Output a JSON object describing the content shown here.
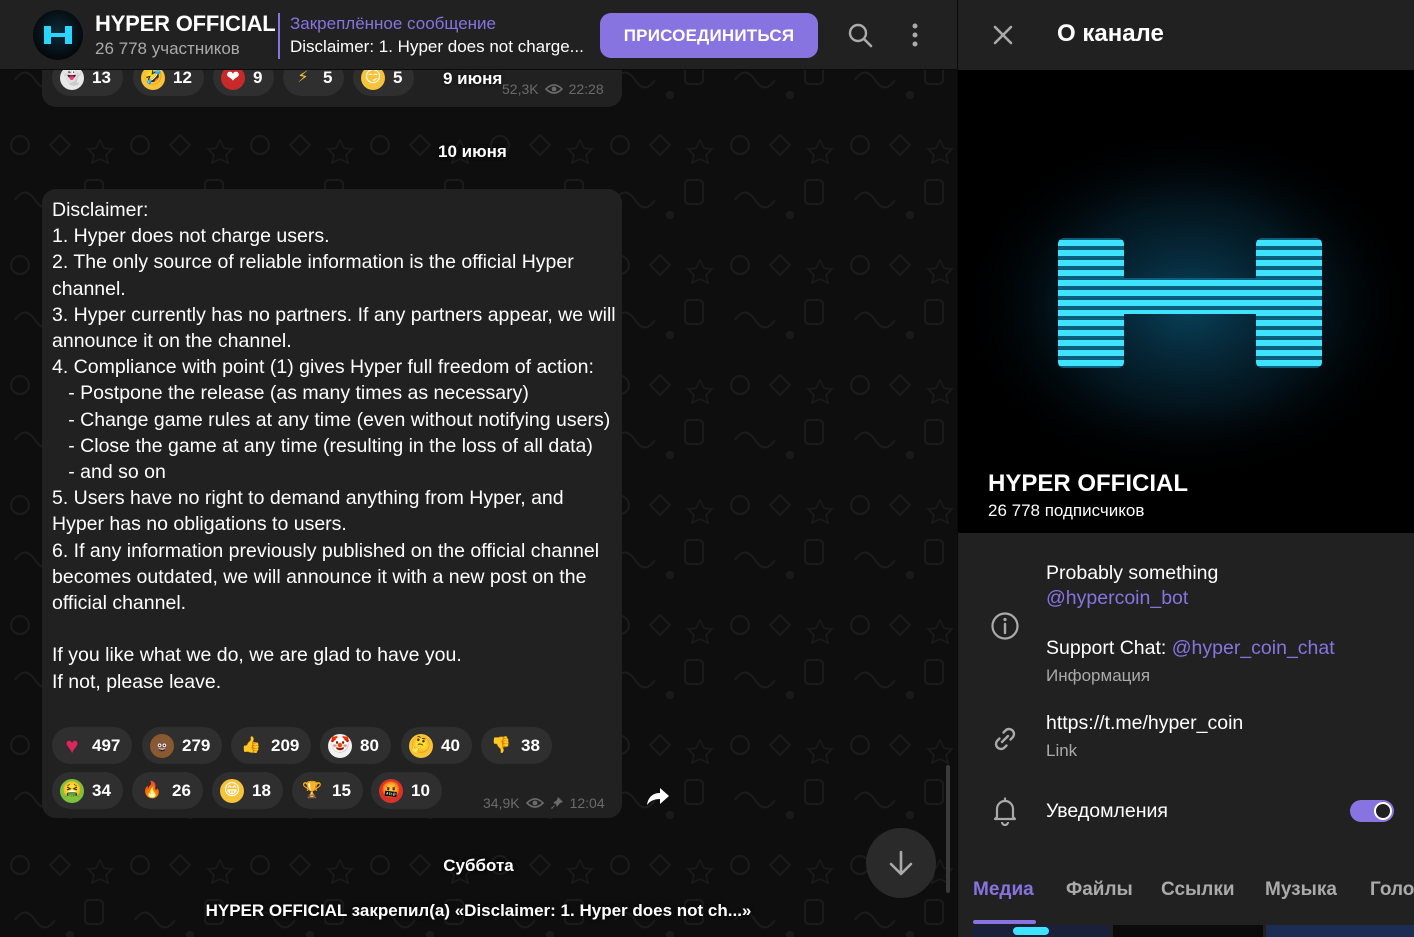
{
  "chat": {
    "header": {
      "title": "HYPER OFFICIAL",
      "subtitle": "26 778 участников",
      "pinned_label": "Закреплённое сообщение",
      "pinned_text": "Disclaimer: 1. Hyper does not charge...",
      "join_label": "ПРИСОЕДИНИТЬСЯ"
    },
    "top_reactions": [
      {
        "emoji": "ghost",
        "count": "13"
      },
      {
        "emoji": "rofl",
        "count": "12"
      },
      {
        "emoji": "heart-on-fire",
        "count": "9"
      },
      {
        "emoji": "lightning",
        "count": "5"
      },
      {
        "emoji": "smirk",
        "count": "5"
      }
    ],
    "top_meta": {
      "views": "52,3K",
      "time": "22:28"
    },
    "date_1": "9 июня",
    "date_2": "10 июня",
    "message": {
      "text": "Disclaimer:\n1. Hyper does not charge users.\n2. The only source of reliable information is the official Hyper channel.\n3. Hyper currently has no partners. If any partners appear, we will announce it on the channel.\n4. Compliance with point (1) gives Hyper full freedom of action:\n   - Postpone the release (as many times as necessary)\n   - Change game rules at any time (even without notifying users)\n   - Close the game at any time (resulting in the loss of all data)\n   - and so on\n5. Users have no right to demand anything from Hyper, and Hyper has no obligations to users.\n6. If any information previously published on the official channel becomes outdated, we will announce it with a new post on the official channel.\n\nIf you like what we do, we are glad to have you.\nIf not, please leave.",
      "reactions": [
        {
          "emoji": "red-heart",
          "count": "497"
        },
        {
          "emoji": "pile-of-poo",
          "count": "279"
        },
        {
          "emoji": "thumbs-up",
          "count": "209"
        },
        {
          "emoji": "clown",
          "count": "80"
        },
        {
          "emoji": "thinking",
          "count": "40"
        },
        {
          "emoji": "thumbs-down",
          "count": "38"
        },
        {
          "emoji": "nauseated",
          "count": "34"
        },
        {
          "emoji": "fire",
          "count": "26"
        },
        {
          "emoji": "grinning",
          "count": "18"
        },
        {
          "emoji": "trophy",
          "count": "15"
        },
        {
          "emoji": "cursing",
          "count": "10"
        }
      ],
      "views": "34,9K",
      "time": "12:04"
    },
    "date_3": "Суббота",
    "service_message": "HYPER OFFICIAL закрепил(а) «Disclaimer: 1. Hyper does not ch...»"
  },
  "info": {
    "title": "О канале",
    "cover_name": "HYPER OFFICIAL",
    "cover_subtitle": "26 778 подписчиков",
    "description_line1": "Probably something",
    "description_link1": "@hypercoin_bot",
    "support_prefix": "Support Chat: ",
    "support_link": "@hyper_coin_chat",
    "info_label": "Информация",
    "link_value": "https://t.me/hyper_coin",
    "link_label": "Link",
    "notifications_label": "Уведомления",
    "notifications_on": true,
    "tabs": [
      "Медиа",
      "Файлы",
      "Ссылки",
      "Музыка",
      "Голо"
    ],
    "active_tab": "Медиа"
  },
  "colors": {
    "accent": "#8774e1",
    "panel": "#212121",
    "bubble": "#212121",
    "reaction_bg": "#2f2f2f",
    "logo_cyan": "#29d6ff"
  }
}
